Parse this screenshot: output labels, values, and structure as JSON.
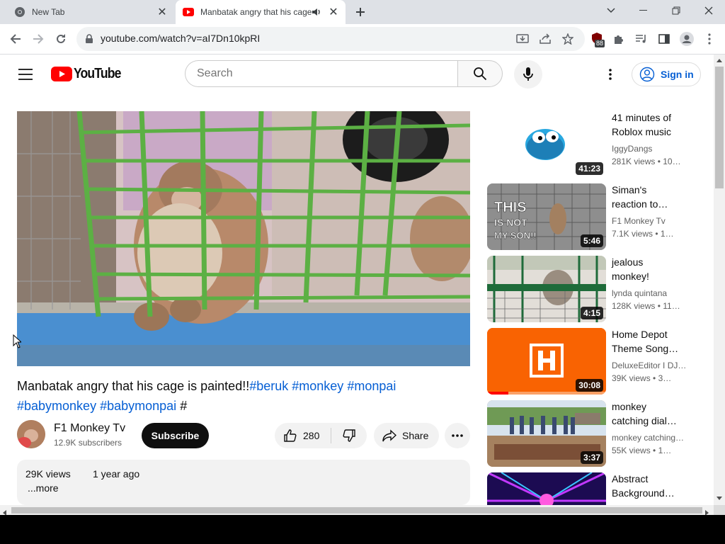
{
  "browser": {
    "tabs": [
      {
        "title": "New Tab",
        "active": false
      },
      {
        "title": "Manbatak angry that his cage",
        "active": true
      }
    ],
    "url": "youtube.com/watch?v=aI7Dn10kpRI",
    "extension_badge": "88"
  },
  "youtube": {
    "logo_text": "YouTube",
    "search_placeholder": "Search",
    "sign_in_label": "Sign in"
  },
  "video": {
    "title_text": "Manbatak angry that his cage is painted!!",
    "hashtags_line1": [
      "#beruk",
      "#monkey",
      "#monpai"
    ],
    "hashtags_line2": [
      "#babymonkey",
      "#babymonpai"
    ],
    "trailing_hash": "#",
    "channel_name": "F1 Monkey Tv",
    "subscribers": "12.9K subscribers",
    "subscribe_label": "Subscribe",
    "likes": "280",
    "share_label": "Share",
    "views": "29K views",
    "date": "1 year ago",
    "more_label": "...more"
  },
  "recommendations": [
    {
      "title_l1": "41 minutes of",
      "title_l2": "Roblox music",
      "channel": "IggyDangs",
      "views": "281K views",
      "age": "10…",
      "duration": "41:23"
    },
    {
      "title_l1": "Siman's",
      "title_l2": "reaction to…",
      "channel": "F1 Monkey Tv",
      "views": "7.1K views",
      "age": "1…",
      "duration": "5:46"
    },
    {
      "title_l1": "jealous",
      "title_l2": "monkey!",
      "channel": "lynda quintana",
      "views": "128K views",
      "age": "11…",
      "duration": "4:15"
    },
    {
      "title_l1": "Home Depot",
      "title_l2": "Theme Song…",
      "channel": "DeluxeEditor I DJ…",
      "views": "39K views",
      "age": "3…",
      "duration": "30:08"
    },
    {
      "title_l1": "monkey",
      "title_l2": "catching dial…",
      "channel": "monkey catching…",
      "views": "55K views",
      "age": "1…",
      "duration": "3:37"
    },
    {
      "title_l1": "Abstract",
      "title_l2": "Background…",
      "channel": "",
      "views": "",
      "age": "",
      "duration": ""
    }
  ],
  "recommendation_overlay_texts": {
    "thumb2_text_l1": "THIS",
    "thumb2_text_l2": "IS NOT",
    "thumb2_text_l3": "MY SON!!"
  },
  "colors": {
    "youtube_red": "#ff0000",
    "link_blue": "#065fd4",
    "home_depot_orange": "#f96302"
  }
}
